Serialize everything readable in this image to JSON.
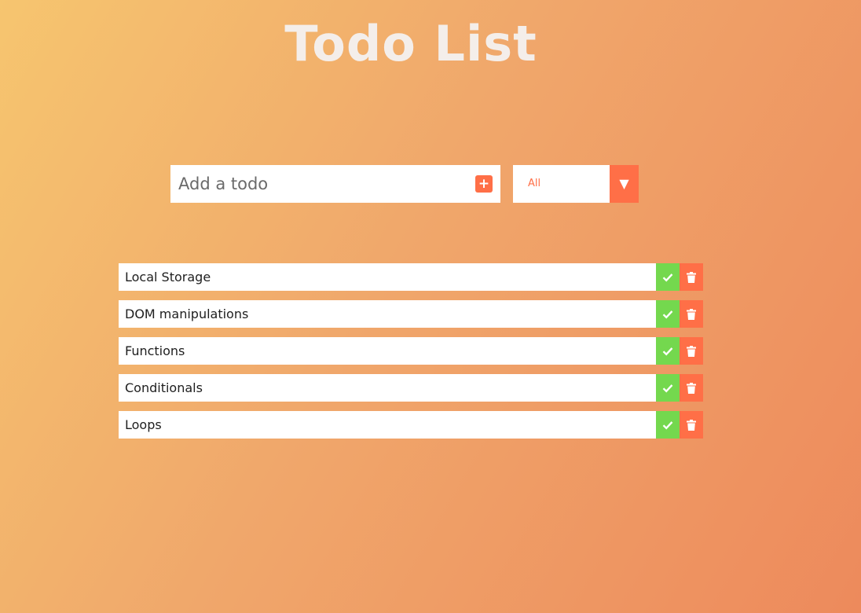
{
  "title": "Todo List",
  "add_todo": {
    "placeholder": "Add a todo",
    "button_icon": "plus-square-icon"
  },
  "filter": {
    "selected": "All",
    "arrow_icon": "caret-down-icon",
    "arrow_glyph": "▼"
  },
  "todos": [
    {
      "text": "Local Storage"
    },
    {
      "text": "DOM manipulations"
    },
    {
      "text": "Functions"
    },
    {
      "text": "Conditionals"
    },
    {
      "text": "Loops"
    }
  ],
  "colors": {
    "accent": "#ff6f47",
    "complete": "#74d84e",
    "title": "#f4eeea"
  },
  "icons": {
    "complete": "check-icon",
    "delete": "trash-icon"
  }
}
